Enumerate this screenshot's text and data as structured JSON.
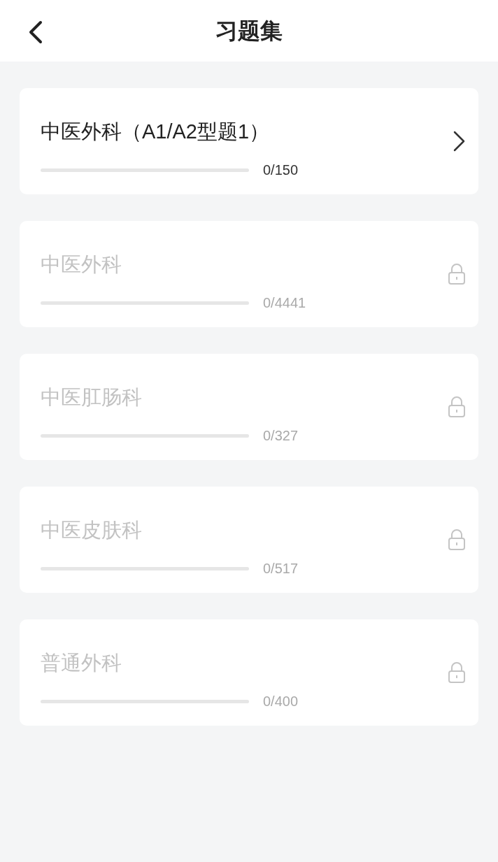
{
  "header": {
    "title": "习题集"
  },
  "sets": [
    {
      "title": "中医外科（A1/A2型题1）",
      "count": "0/150",
      "level": 0,
      "locked": false
    },
    {
      "title": "中医外科",
      "count": "0/4441",
      "level": 0,
      "locked": true
    },
    {
      "title": "中医肛肠科",
      "count": "0/327",
      "level": 0,
      "locked": true
    },
    {
      "title": "中医皮肤科",
      "count": "0/517",
      "level": 0,
      "locked": true
    },
    {
      "title": "普通外科",
      "count": "0/400",
      "level": 0,
      "locked": true
    }
  ]
}
